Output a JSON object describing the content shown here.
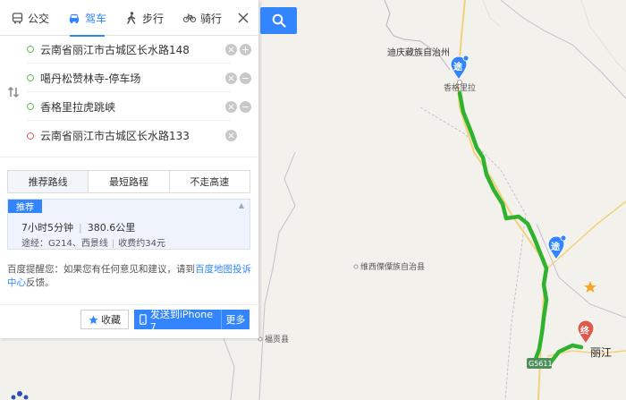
{
  "tabs": [
    {
      "label": "公交",
      "icon": "bus-icon"
    },
    {
      "label": "驾车",
      "icon": "car-icon"
    },
    {
      "label": "步行",
      "icon": "walk-icon"
    },
    {
      "label": "骑行",
      "icon": "bike-icon"
    }
  ],
  "waypoints": [
    {
      "text": "云南省丽江市古城区长水路148",
      "type": "start"
    },
    {
      "text": "噶丹松赞林寺-停车场",
      "type": "via"
    },
    {
      "text": "香格里拉虎跳峡",
      "type": "via"
    },
    {
      "text": "云南省丽江市古城区长水路133",
      "type": "end"
    }
  ],
  "route_tabs": [
    "推荐路线",
    "最短路程",
    "不走高速"
  ],
  "route": {
    "badge": "推荐",
    "duration": "7小时5分钟",
    "distance": "380.6公里",
    "via_label": "途经：",
    "via": "G214、西景线",
    "toll": "收费约34元"
  },
  "feedback": {
    "prefix": "百度提醒您：如果您有任何意见和建议，请到",
    "link": "百度地图投诉中心",
    "suffix": "反馈。"
  },
  "buttons": {
    "favorite": "收藏",
    "send": "发送到iPhone 7",
    "more": "更多"
  },
  "map": {
    "labels": {
      "diqing": "迪庆藏族自治州",
      "xianggelila": "香格里拉",
      "weixi": "维西傈僳族自治县",
      "fugong": "福贡县",
      "lijiang": "丽江",
      "highway": "G5611"
    },
    "markers": {
      "via": "途",
      "end": "终"
    },
    "colors": {
      "route": "#2fb32f",
      "accent": "#3385ff",
      "end_marker": "#e2574c"
    }
  }
}
